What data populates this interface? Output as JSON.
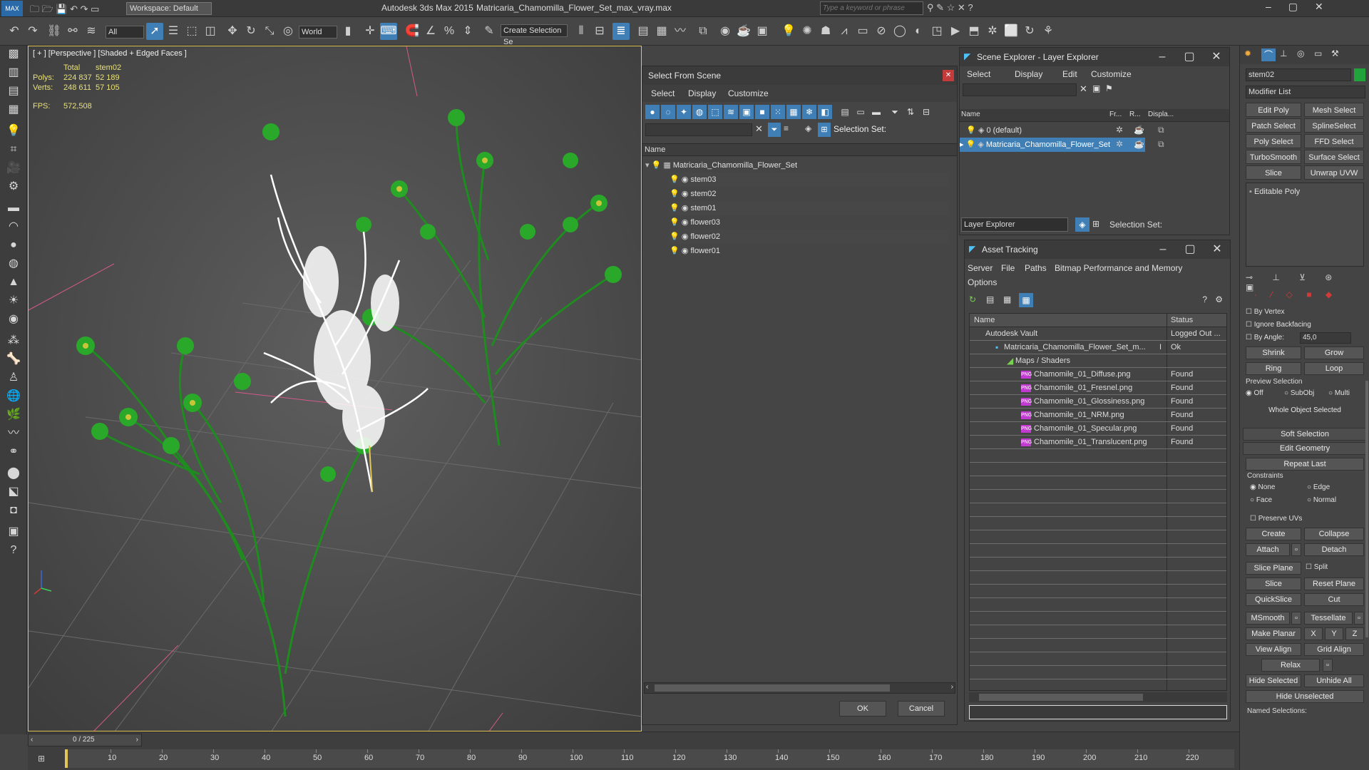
{
  "titlebar": {
    "app_title": "Autodesk 3ds Max  2015",
    "file_title": "Matricaria_Chamomilla_Flower_Set_max_vray.max",
    "workspace": "Workspace: Default",
    "search_placeholder": "Type a keyword or phrase",
    "app_logo": "MAX"
  },
  "toolbar": {
    "filter_value": "All",
    "coord_value": "World",
    "selection_set_value": "Create Selection Se"
  },
  "viewport": {
    "label": "[ + ] [Perspective ] [Shaded + Edged Faces ]",
    "stats": {
      "col_total": "Total",
      "col_object": "stem02",
      "polys_label": "Polys:",
      "polys_total": "224 837",
      "polys_object": "52 189",
      "verts_label": "Verts:",
      "verts_total": "248 611",
      "verts_object": "57 105",
      "fps_label": "FPS:",
      "fps_value": "572,508"
    }
  },
  "select_dialog": {
    "title": "Select From Scene",
    "menus": [
      "Select",
      "Display",
      "Customize"
    ],
    "selection_set_label": "Selection Set:",
    "column_name": "Name",
    "root": "Matricaria_Chamomilla_Flower_Set",
    "items": [
      "stem03",
      "stem02",
      "stem01",
      "flower03",
      "flower02",
      "flower01"
    ],
    "ok": "OK",
    "cancel": "Cancel"
  },
  "scene_explorer": {
    "title": "Scene Explorer - Layer Explorer",
    "menus": [
      "Select",
      "Display",
      "Edit",
      "Customize"
    ],
    "columns": [
      "Name",
      "Fr...",
      "R...",
      "Displa..."
    ],
    "rows": [
      "0 (default)",
      "Matricaria_Chamomilla_Flower_Set"
    ],
    "explorer_select": "Layer Explorer",
    "selection_set_label": "Selection Set:"
  },
  "asset_tracking": {
    "title": "Asset Tracking",
    "menus": [
      "Server",
      "File",
      "Paths",
      "Bitmap Performance and Memory",
      "Options"
    ],
    "col_name": "Name",
    "col_status": "Status",
    "rows": [
      {
        "name": "Autodesk Vault",
        "flag": "",
        "status": "Logged Out ..."
      },
      {
        "name": "Matricaria_Chamomilla_Flower_Set_m...",
        "flag": "I",
        "status": "Ok"
      },
      {
        "name": "Maps / Shaders",
        "flag": "",
        "status": ""
      },
      {
        "name": "Chamomile_01_Diffuse.png",
        "flag": "",
        "status": "Found"
      },
      {
        "name": "Chamomile_01_Fresnel.png",
        "flag": "",
        "status": "Found"
      },
      {
        "name": "Chamomile_01_Glossiness.png",
        "flag": "",
        "status": "Found"
      },
      {
        "name": "Chamomile_01_NRM.png",
        "flag": "",
        "status": "Found"
      },
      {
        "name": "Chamomile_01_Specular.png",
        "flag": "",
        "status": "Found"
      },
      {
        "name": "Chamomile_01_Translucent.png",
        "flag": "",
        "status": "Found"
      }
    ]
  },
  "command_panel": {
    "object_name": "stem02",
    "modifier_list": "Modifier List",
    "modifier_buttons": [
      "Edit Poly",
      "Mesh Select",
      "Patch Select",
      "SplineSelect",
      "Poly Select",
      "FFD Select",
      "TurboSmooth",
      "Surface Select",
      "Slice",
      "Unwrap UVW"
    ],
    "stack_item": "Editable Poly",
    "by_vertex": "By Vertex",
    "ignore_backfacing": "Ignore Backfacing",
    "by_angle": "By Angle:",
    "by_angle_value": "45,0",
    "shrink": "Shrink",
    "grow": "Grow",
    "ring": "Ring",
    "loop": "Loop",
    "preview_selection": "Preview Selection",
    "preview_off": "Off",
    "preview_subobj": "SubObj",
    "preview_multi": "Multi",
    "whole_object": "Whole Object Selected",
    "soft_selection": "Soft Selection",
    "edit_geometry": "Edit Geometry",
    "repeat_last": "Repeat Last",
    "constraints": "Constraints",
    "c_none": "None",
    "c_edge": "Edge",
    "c_face": "Face",
    "c_normal": "Normal",
    "preserve_uvs": "Preserve UVs",
    "create": "Create",
    "collapse": "Collapse",
    "attach": "Attach",
    "detach": "Detach",
    "slice_plane": "Slice Plane",
    "split": "Split",
    "slice": "Slice",
    "reset_plane": "Reset Plane",
    "quickslice": "QuickSlice",
    "cut": "Cut",
    "msmooth": "MSmooth",
    "tessellate": "Tessellate",
    "make_planar": "Make Planar",
    "x": "X",
    "y": "Y",
    "z": "Z",
    "view_align": "View Align",
    "grid_align": "Grid Align",
    "relax": "Relax",
    "hide_selected": "Hide Selected",
    "unhide_all": "Unhide All",
    "hide_unselected": "Hide Unselected",
    "named_selections": "Named Selections:"
  },
  "timeline": {
    "frame": "0 / 225",
    "ticks": [
      "10",
      "20",
      "30",
      "40",
      "50",
      "60",
      "70",
      "80",
      "90",
      "100",
      "110",
      "120",
      "130",
      "140",
      "150",
      "160",
      "170",
      "180",
      "190",
      "200",
      "210",
      "220"
    ]
  },
  "colors": {
    "selection_blue": "#3f7fb5",
    "plant_green": "#1e8c1e",
    "selected_white": "#ffffff",
    "viewport_border": "#e3c65a"
  }
}
